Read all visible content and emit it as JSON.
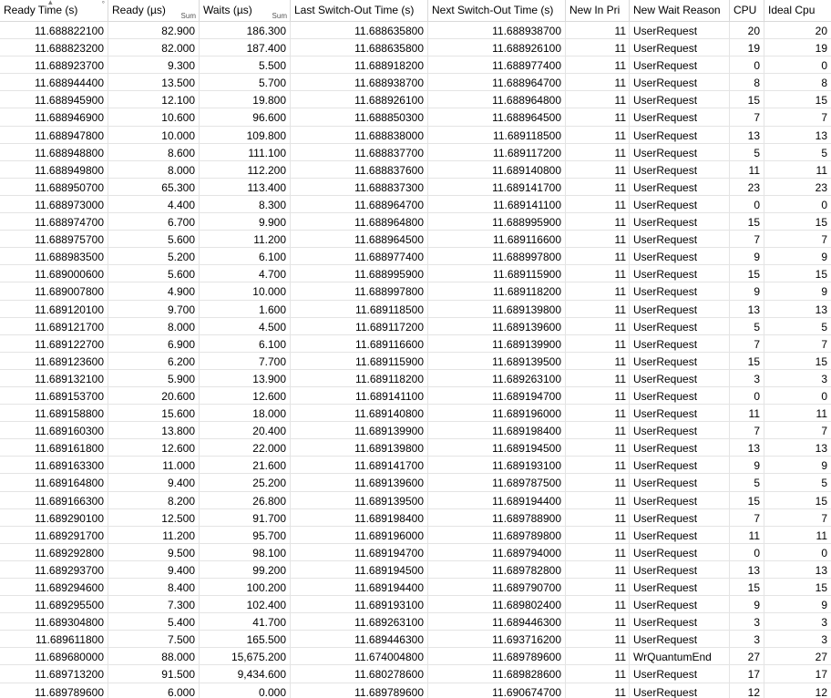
{
  "columns": [
    {
      "label": "Ready Time (s)",
      "agg": "",
      "sorted": true
    },
    {
      "label": "Ready (µs)",
      "agg": "Sum"
    },
    {
      "label": "Waits (µs)",
      "agg": "Sum"
    },
    {
      "label": "Last Switch-Out Time (s)",
      "agg": ""
    },
    {
      "label": "Next Switch-Out Time (s)",
      "agg": ""
    },
    {
      "label": "New In Pri",
      "agg": ""
    },
    {
      "label": "New Wait Reason",
      "agg": ""
    },
    {
      "label": "CPU",
      "agg": ""
    },
    {
      "label": "Ideal Cpu",
      "agg": ""
    }
  ],
  "icons": {
    "sort": "sort-ascending-icon",
    "pin": "column-pin-icon"
  },
  "rows": [
    [
      "11.688822100",
      "82.900",
      "186.300",
      "11.688635800",
      "11.688938700",
      "11",
      "UserRequest",
      "20",
      "20"
    ],
    [
      "11.688823200",
      "82.000",
      "187.400",
      "11.688635800",
      "11.688926100",
      "11",
      "UserRequest",
      "19",
      "19"
    ],
    [
      "11.688923700",
      "9.300",
      "5.500",
      "11.688918200",
      "11.688977400",
      "11",
      "UserRequest",
      "0",
      "0"
    ],
    [
      "11.688944400",
      "13.500",
      "5.700",
      "11.688938700",
      "11.688964700",
      "11",
      "UserRequest",
      "8",
      "8"
    ],
    [
      "11.688945900",
      "12.100",
      "19.800",
      "11.688926100",
      "11.688964800",
      "11",
      "UserRequest",
      "15",
      "15"
    ],
    [
      "11.688946900",
      "10.600",
      "96.600",
      "11.688850300",
      "11.688964500",
      "11",
      "UserRequest",
      "7",
      "7"
    ],
    [
      "11.688947800",
      "10.000",
      "109.800",
      "11.688838000",
      "11.689118500",
      "11",
      "UserRequest",
      "13",
      "13"
    ],
    [
      "11.688948800",
      "8.600",
      "111.100",
      "11.688837700",
      "11.689117200",
      "11",
      "UserRequest",
      "5",
      "5"
    ],
    [
      "11.688949800",
      "8.000",
      "112.200",
      "11.688837600",
      "11.689140800",
      "11",
      "UserRequest",
      "11",
      "11"
    ],
    [
      "11.688950700",
      "65.300",
      "113.400",
      "11.688837300",
      "11.689141700",
      "11",
      "UserRequest",
      "23",
      "23"
    ],
    [
      "11.688973000",
      "4.400",
      "8.300",
      "11.688964700",
      "11.689141100",
      "11",
      "UserRequest",
      "0",
      "0"
    ],
    [
      "11.688974700",
      "6.700",
      "9.900",
      "11.688964800",
      "11.688995900",
      "11",
      "UserRequest",
      "15",
      "15"
    ],
    [
      "11.688975700",
      "5.600",
      "11.200",
      "11.688964500",
      "11.689116600",
      "11",
      "UserRequest",
      "7",
      "7"
    ],
    [
      "11.688983500",
      "5.200",
      "6.100",
      "11.688977400",
      "11.688997800",
      "11",
      "UserRequest",
      "9",
      "9"
    ],
    [
      "11.689000600",
      "5.600",
      "4.700",
      "11.688995900",
      "11.689115900",
      "11",
      "UserRequest",
      "15",
      "15"
    ],
    [
      "11.689007800",
      "4.900",
      "10.000",
      "11.688997800",
      "11.689118200",
      "11",
      "UserRequest",
      "9",
      "9"
    ],
    [
      "11.689120100",
      "9.700",
      "1.600",
      "11.689118500",
      "11.689139800",
      "11",
      "UserRequest",
      "13",
      "13"
    ],
    [
      "11.689121700",
      "8.000",
      "4.500",
      "11.689117200",
      "11.689139600",
      "11",
      "UserRequest",
      "5",
      "5"
    ],
    [
      "11.689122700",
      "6.900",
      "6.100",
      "11.689116600",
      "11.689139900",
      "11",
      "UserRequest",
      "7",
      "7"
    ],
    [
      "11.689123600",
      "6.200",
      "7.700",
      "11.689115900",
      "11.689139500",
      "11",
      "UserRequest",
      "15",
      "15"
    ],
    [
      "11.689132100",
      "5.900",
      "13.900",
      "11.689118200",
      "11.689263100",
      "11",
      "UserRequest",
      "3",
      "3"
    ],
    [
      "11.689153700",
      "20.600",
      "12.600",
      "11.689141100",
      "11.689194700",
      "11",
      "UserRequest",
      "0",
      "0"
    ],
    [
      "11.689158800",
      "15.600",
      "18.000",
      "11.689140800",
      "11.689196000",
      "11",
      "UserRequest",
      "11",
      "11"
    ],
    [
      "11.689160300",
      "13.800",
      "20.400",
      "11.689139900",
      "11.689198400",
      "11",
      "UserRequest",
      "7",
      "7"
    ],
    [
      "11.689161800",
      "12.600",
      "22.000",
      "11.689139800",
      "11.689194500",
      "11",
      "UserRequest",
      "13",
      "13"
    ],
    [
      "11.689163300",
      "11.000",
      "21.600",
      "11.689141700",
      "11.689193100",
      "11",
      "UserRequest",
      "9",
      "9"
    ],
    [
      "11.689164800",
      "9.400",
      "25.200",
      "11.689139600",
      "11.689787500",
      "11",
      "UserRequest",
      "5",
      "5"
    ],
    [
      "11.689166300",
      "8.200",
      "26.800",
      "11.689139500",
      "11.689194400",
      "11",
      "UserRequest",
      "15",
      "15"
    ],
    [
      "11.689290100",
      "12.500",
      "91.700",
      "11.689198400",
      "11.689788900",
      "11",
      "UserRequest",
      "7",
      "7"
    ],
    [
      "11.689291700",
      "11.200",
      "95.700",
      "11.689196000",
      "11.689789800",
      "11",
      "UserRequest",
      "11",
      "11"
    ],
    [
      "11.689292800",
      "9.500",
      "98.100",
      "11.689194700",
      "11.689794000",
      "11",
      "UserRequest",
      "0",
      "0"
    ],
    [
      "11.689293700",
      "9.400",
      "99.200",
      "11.689194500",
      "11.689782800",
      "11",
      "UserRequest",
      "13",
      "13"
    ],
    [
      "11.689294600",
      "8.400",
      "100.200",
      "11.689194400",
      "11.689790700",
      "11",
      "UserRequest",
      "15",
      "15"
    ],
    [
      "11.689295500",
      "7.300",
      "102.400",
      "11.689193100",
      "11.689802400",
      "11",
      "UserRequest",
      "9",
      "9"
    ],
    [
      "11.689304800",
      "5.400",
      "41.700",
      "11.689263100",
      "11.689446300",
      "11",
      "UserRequest",
      "3",
      "3"
    ],
    [
      "11.689611800",
      "7.500",
      "165.500",
      "11.689446300",
      "11.693716200",
      "11",
      "UserRequest",
      "3",
      "3"
    ],
    [
      "11.689680000",
      "88.000",
      "15,675.200",
      "11.674004800",
      "11.689789600",
      "11",
      "WrQuantumEnd",
      "27",
      "27"
    ],
    [
      "11.689713200",
      "91.500",
      "9,434.600",
      "11.680278600",
      "11.689828600",
      "11",
      "UserRequest",
      "17",
      "17"
    ],
    [
      "11.689789600",
      "6.000",
      "0.000",
      "11.689789600",
      "11.690674700",
      "11",
      "UserRequest",
      "12",
      "12"
    ]
  ]
}
